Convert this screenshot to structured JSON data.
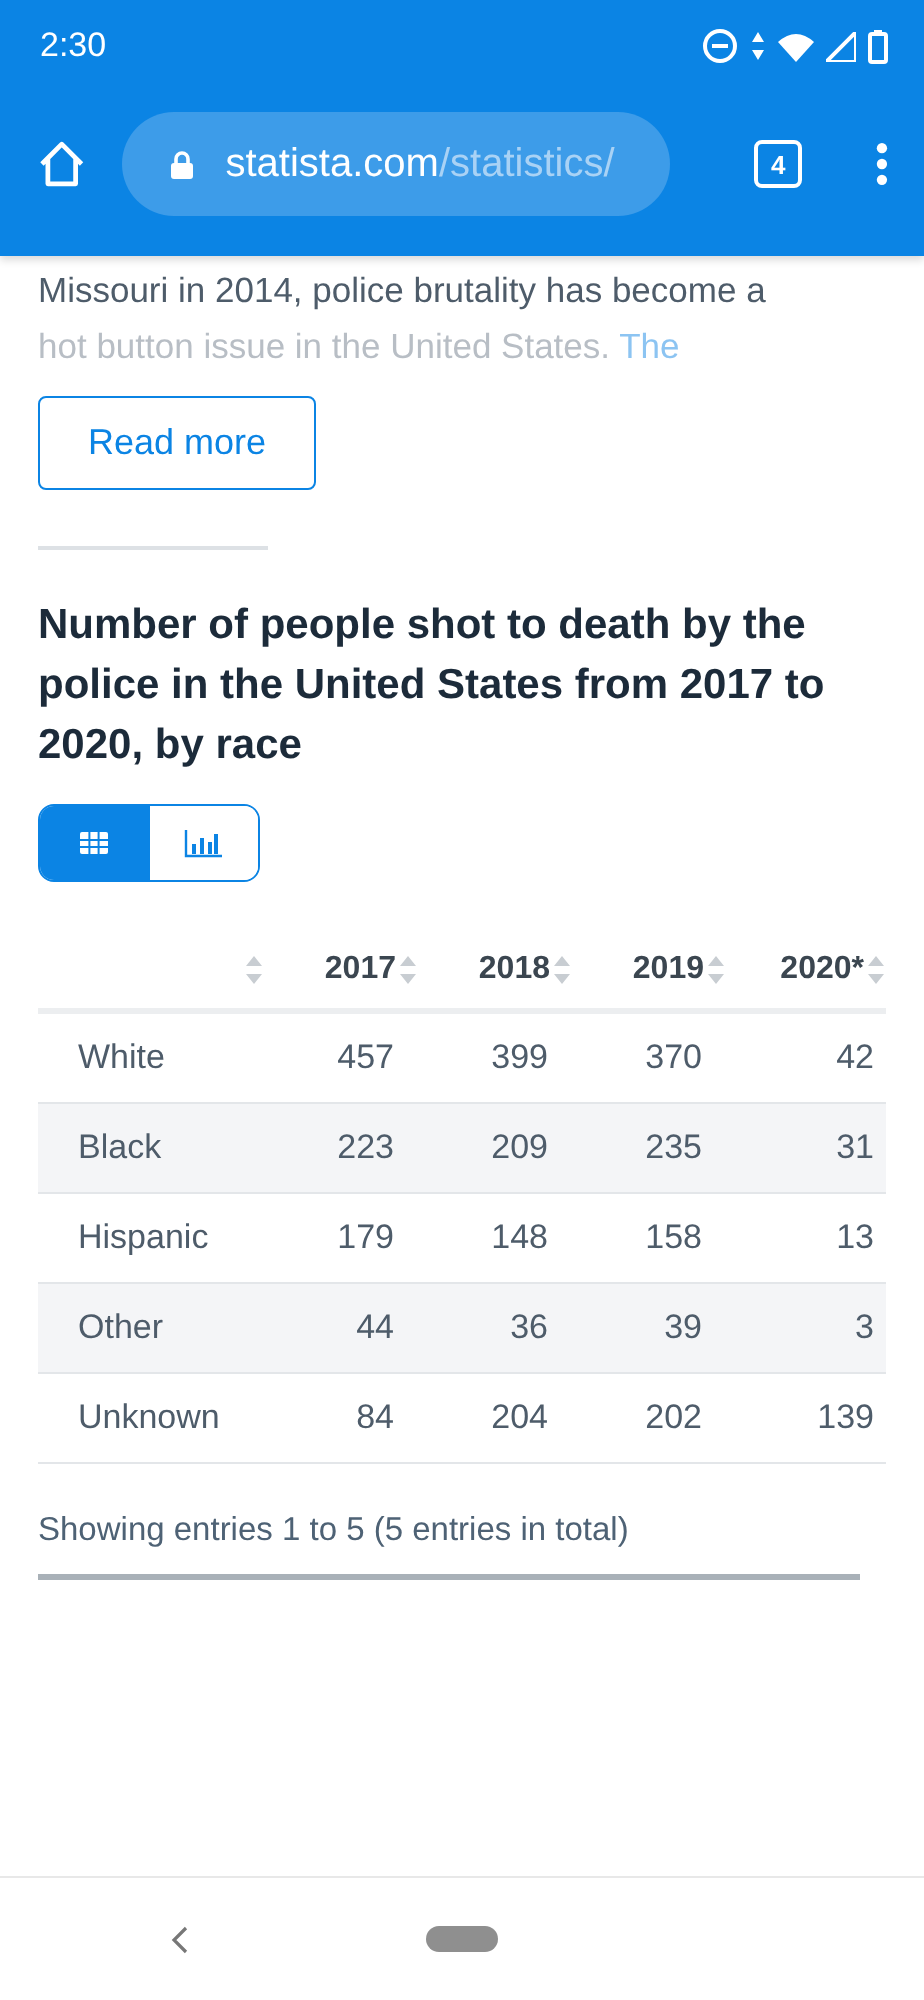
{
  "status_bar": {
    "time": "2:30"
  },
  "browser": {
    "domain": "statista.com",
    "path": "/statistics/",
    "tab_count": "4"
  },
  "article": {
    "line_1": "Missouri in 2014, police brutality has become a",
    "line_2": "hot button issue in the United States.",
    "link": "The",
    "button": "Read more"
  },
  "statistic": {
    "title": "Number of people shot to death by the police in the United States from 2017 to 2020, by race",
    "view_toggle": [
      {
        "kind": "table",
        "selected": true
      },
      {
        "kind": "chart",
        "selected": false
      }
    ],
    "table": {
      "columns": [
        "2017",
        "2018",
        "2019",
        "2020*"
      ],
      "rows": [
        {
          "label": "White",
          "values": [
            "457",
            "399",
            "370",
            "42"
          ]
        },
        {
          "label": "Black",
          "values": [
            "223",
            "209",
            "235",
            "31"
          ]
        },
        {
          "label": "Hispanic",
          "values": [
            "179",
            "148",
            "158",
            "13"
          ]
        },
        {
          "label": "Other",
          "values": [
            "44",
            "36",
            "39",
            "3"
          ]
        },
        {
          "label": "Unknown",
          "values": [
            "84",
            "204",
            "202",
            "139"
          ]
        }
      ]
    },
    "footer": "Showing entries 1 to 5 (5 entries in total)"
  }
}
